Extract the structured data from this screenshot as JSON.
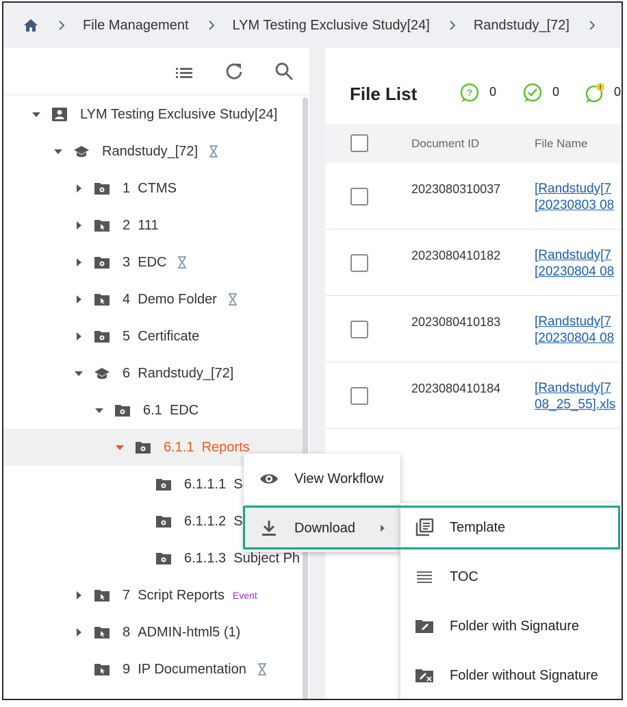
{
  "breadcrumb": {
    "home_icon": "home-icon",
    "items": [
      "File Management",
      "LYM Testing Exclusive Study[24]",
      "Randstudy_[72]"
    ]
  },
  "tree": {
    "toolbar": [
      "list-icon",
      "refresh-icon",
      "search-icon"
    ],
    "rows": [
      {
        "label": "LYM Testing Exclusive Study[24]",
        "num": ""
      },
      {
        "label": "Randstudy_[72]",
        "num": ""
      },
      {
        "num": "1",
        "label": "CTMS"
      },
      {
        "num": "2",
        "label": "111"
      },
      {
        "num": "3",
        "label": "EDC"
      },
      {
        "num": "4",
        "label": "Demo Folder"
      },
      {
        "num": "5",
        "label": "Certificate"
      },
      {
        "num": "6",
        "label": "Randstudy_[72]"
      },
      {
        "num": "6.1",
        "label": "EDC"
      },
      {
        "num": "6.1.1",
        "label": "Reports"
      },
      {
        "num": "6.1.1.1",
        "label": "Su"
      },
      {
        "num": "6.1.1.2",
        "label": "S"
      },
      {
        "num": "6.1.1.3",
        "label": "Subject Ph"
      },
      {
        "num": "7",
        "label": "Script Reports",
        "tag": "Event"
      },
      {
        "num": "8",
        "label": "ADMIN-html5 (1)"
      },
      {
        "num": "9",
        "label": "IP Documentation"
      }
    ]
  },
  "file_list": {
    "title": "File List",
    "stats": [
      "0",
      "0",
      "0"
    ],
    "columns": {
      "doc_id": "Document ID",
      "file_name": "File Name"
    },
    "rows": [
      {
        "doc_id": "2023080310037",
        "name_line1": "[Randstudy[7",
        "name_line2": "[20230803 08"
      },
      {
        "doc_id": "2023080410182",
        "name_line1": "[Randstudy[7",
        "name_line2": "[20230804 08"
      },
      {
        "doc_id": "2023080410183",
        "name_line1": "[Randstudy[7",
        "name_line2": "[20230804 08"
      },
      {
        "doc_id": "2023080410184",
        "name_line1": "[Randstudy[7",
        "name_line2": "08_25_55].xls"
      }
    ]
  },
  "context_menu": {
    "view_workflow": "View Workflow",
    "download": "Download"
  },
  "download_submenu": {
    "template": "Template",
    "toc": "TOC",
    "with_sig": "Folder with Signature",
    "without_sig": "Folder without Signature"
  },
  "colors": {
    "selected": "#ee5a1d",
    "accent_green": "#5ec22d",
    "highlight": "#1ba68c",
    "link": "#1a5fae",
    "event": "#9b30d9"
  }
}
